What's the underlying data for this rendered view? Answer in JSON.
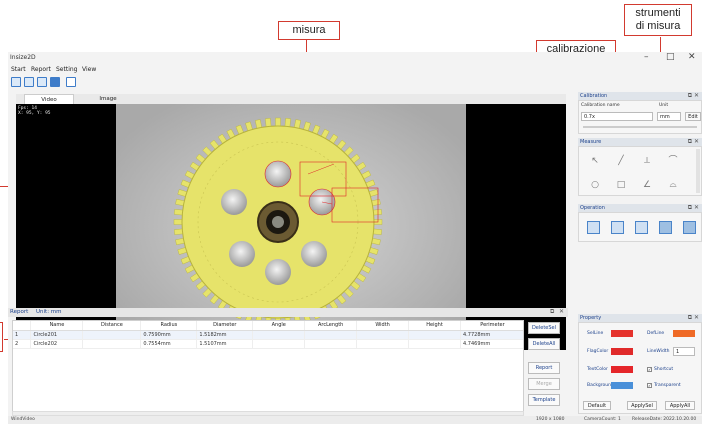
{
  "callouts": {
    "measure": "misura",
    "calibration": "calibrazione",
    "tools": [
      "strumenti",
      "di misura"
    ]
  },
  "app": {
    "title": "Insize2D",
    "win_controls": [
      "–",
      "□",
      "✕"
    ],
    "menu": [
      "Start",
      "Report",
      "Setting",
      "View"
    ]
  },
  "tabs": [
    "Video",
    "Image"
  ],
  "viewport": {
    "overlay": [
      "Fps: 14",
      "X: 95, Y: 95"
    ],
    "gear_color": "#e6e36a",
    "annotation_color": "#e0262a"
  },
  "report": {
    "title": "Report",
    "unit": "Unit: mm",
    "columns": [
      "",
      "Name",
      "Distance",
      "Radius",
      "Diameter",
      "Angle",
      "ArcLength",
      "Width",
      "Height",
      "Perimeter"
    ],
    "rows": [
      [
        "1",
        "Circle201",
        "",
        "0.7590mm",
        "1.5182mm",
        "",
        "",
        "",
        "",
        "4.7728mm"
      ],
      [
        "2",
        "Circle202",
        "",
        "0.7554mm",
        "1.5107mm",
        "",
        "",
        "",
        "",
        "4.7469mm"
      ]
    ],
    "buttons": [
      "DeleteSel",
      "DeleteAll",
      "Report",
      "Merge",
      "Template"
    ]
  },
  "calibration": {
    "title": "Calibration",
    "name_label": "Calibration name",
    "unit_label": "Unit",
    "name_value": "0.7x",
    "unit_value": "mm",
    "edit_label": "Edit"
  },
  "measure": {
    "title": "Measure",
    "tool_icons": [
      "pointer-icon",
      "line-icon",
      "perpendicular-icon",
      "arc-icon",
      "circle-icon",
      "rect-icon",
      "angle-icon",
      "polyline-icon"
    ]
  },
  "operation": {
    "title": "Operation",
    "icons": [
      "print-icon",
      "save-icon",
      "fit-icon",
      "snapshot-icon",
      "export-icon"
    ]
  },
  "property": {
    "title": "Property",
    "sel_line": "SelLine",
    "sel_line_color": "#e5322c",
    "def_line": "DefLine",
    "def_line_color": "#ef6a26",
    "flag_color": "FlagColor",
    "flag_color_value": "#e02a2a",
    "line_width": "LineWidth",
    "line_width_value": "1",
    "text_color": "TextColor",
    "text_color_value": "#e5262a",
    "shortcut": "Shortcut",
    "background": "Background",
    "background_value": "#4a90d9",
    "transparent": "Transparent",
    "default_btn": "Default",
    "apply_sel": "ApplySel",
    "apply_all": "ApplyAll"
  },
  "status": {
    "left": "WindVideo",
    "resolution": "1920 x 1080",
    "camera": "CameraCount: 1",
    "date": "ReleaseDate: 2022.10.20.00"
  }
}
